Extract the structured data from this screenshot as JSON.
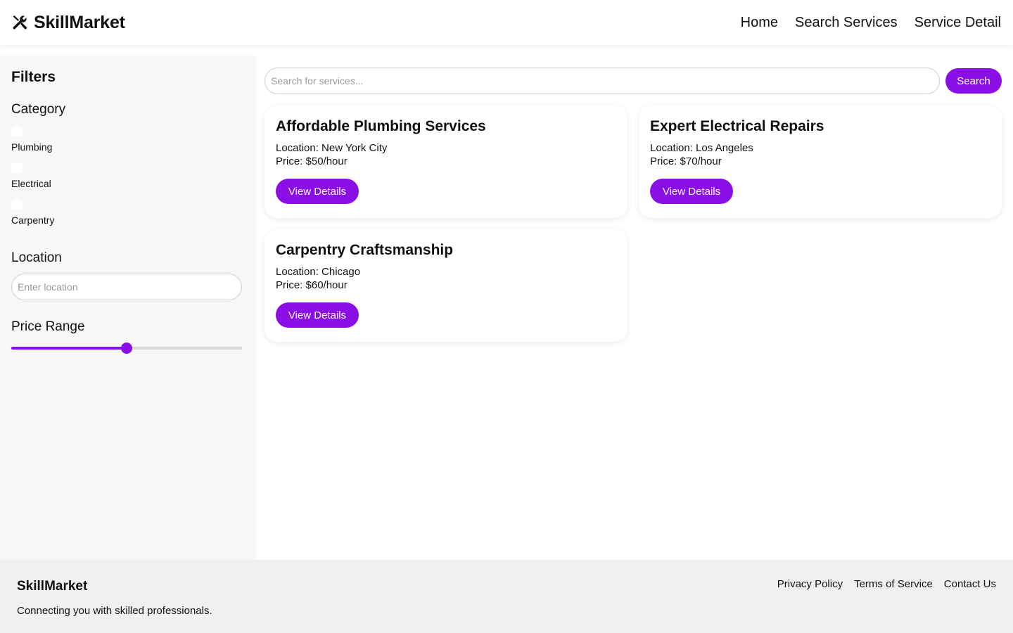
{
  "header": {
    "brand": "SkillMarket",
    "nav": [
      "Home",
      "Search Services",
      "Service Detail"
    ]
  },
  "sidebar": {
    "title": "Filters",
    "category": {
      "title": "Category",
      "items": [
        {
          "label": "Plumbing",
          "checked": false
        },
        {
          "label": "Electrical",
          "checked": false
        },
        {
          "label": "Carpentry",
          "checked": false
        }
      ]
    },
    "location": {
      "title": "Location",
      "placeholder": "Enter location",
      "value": ""
    },
    "price": {
      "title": "Price Range",
      "value_fraction": 0.5
    }
  },
  "main": {
    "search": {
      "placeholder": "Search for services...",
      "value": "",
      "button": "Search"
    },
    "services": [
      {
        "title": "Affordable Plumbing Services",
        "location": "Location: New York City",
        "price": "Price: $50/hour",
        "button": "View Details"
      },
      {
        "title": "Expert Electrical Repairs",
        "location": "Location: Los Angeles",
        "price": "Price: $70/hour",
        "button": "View Details"
      },
      {
        "title": "Carpentry Craftsmanship",
        "location": "Location: Chicago",
        "price": "Price: $60/hour",
        "button": "View Details"
      }
    ]
  },
  "footer": {
    "brand": "SkillMarket",
    "tagline": "Connecting you with skilled professionals.",
    "links": [
      "Privacy Policy",
      "Terms of Service",
      "Contact Us"
    ]
  },
  "colors": {
    "accent": "#8a0ee6",
    "sidebar_bg": "#f7f7f7",
    "footer_bg": "#f0f0f0"
  },
  "icons": {
    "brand": "tools-icon"
  }
}
